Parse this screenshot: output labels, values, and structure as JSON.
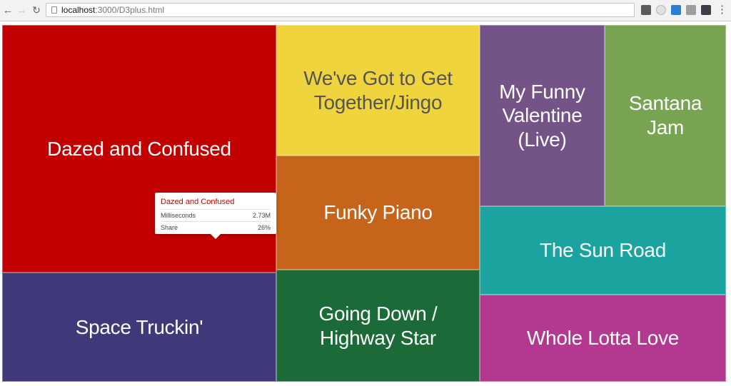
{
  "browser": {
    "url_host": "localhost",
    "url_path": ":3000/D3plus.html",
    "icons": {
      "back": "arrow-left-icon",
      "forward": "arrow-right-icon",
      "reload": "reload-icon",
      "menu": "kebab-menu-icon"
    }
  },
  "colors": {
    "dazed": "#c10000",
    "space": "#3f3879",
    "together": "#f0d43e",
    "funky": "#c5641a",
    "going": "#1b6a37",
    "valentine": "#745487",
    "santana": "#78a351",
    "sun": "#1aa39f",
    "whole": "#b2398f"
  },
  "treemap": {
    "tiles": [
      {
        "id": "dazed-and-confused",
        "label": "Dazed and Confused"
      },
      {
        "id": "space-truckin",
        "label": "Space Truckin'"
      },
      {
        "id": "got-to-get-together",
        "label": "We've Got to Get Together/Jingo"
      },
      {
        "id": "funky-piano",
        "label": "Funky Piano"
      },
      {
        "id": "going-down-highway-star",
        "label": "Going Down / Highway Star"
      },
      {
        "id": "my-funny-valentine",
        "label": "My Funny Valentine (Live)"
      },
      {
        "id": "santana-jam",
        "label": "Santana Jam"
      },
      {
        "id": "the-sun-road",
        "label": "The Sun Road"
      },
      {
        "id": "whole-lotta-love",
        "label": "Whole Lotta Love"
      }
    ]
  },
  "tooltip": {
    "title": "Dazed and Confused",
    "rows": [
      {
        "label": "Milliseconds",
        "value": "2.73M"
      },
      {
        "label": "Share",
        "value": "26%"
      }
    ]
  }
}
